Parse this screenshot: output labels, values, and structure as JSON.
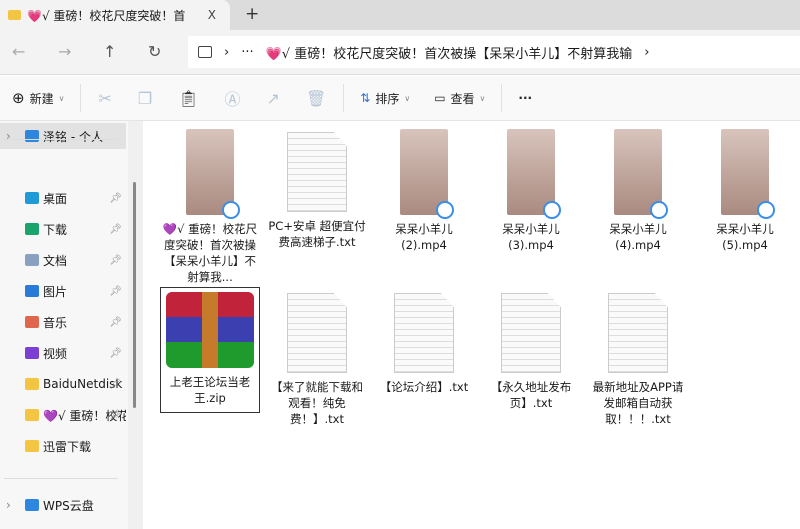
{
  "tab": {
    "title": "💗√ 重磅！校花尺度突破！首",
    "close": "X",
    "new": "+"
  },
  "nav": {
    "back": "←",
    "forward": "→",
    "up": "↑",
    "refresh": "↻",
    "sep": "›",
    "more": "···",
    "path": "💗√ 重磅！校花尺度突破！首次被操【呆呆小羊儿】不射算我输",
    "end": "›"
  },
  "toolbar": {
    "new": "新建",
    "sort": "排序",
    "view": "查看",
    "more": "···"
  },
  "sidebar": {
    "items": [
      {
        "label": "泽铭 - 个人",
        "color": "#2f86de"
      },
      {
        "label": "桌面",
        "color": "#1f9ad6"
      },
      {
        "label": "下载",
        "color": "#1aa36d"
      },
      {
        "label": "文档",
        "color": "#8aa0c0"
      },
      {
        "label": "图片",
        "color": "#2a7ad8"
      },
      {
        "label": "音乐",
        "color": "#e0664e"
      },
      {
        "label": "视频",
        "color": "#7b3fd2"
      },
      {
        "label": "BaiduNetdisk",
        "color": "#f4c542"
      },
      {
        "label": "💜√ 重磅！校花",
        "color": "#f4c542"
      },
      {
        "label": "迅雷下载",
        "color": "#f4c542"
      },
      {
        "label": "WPS云盘",
        "color": "#2f86de"
      }
    ]
  },
  "files": [
    {
      "name": "💜√ 重磅！校花尺度突破！首次被操【呆呆小羊儿】不射算我...",
      "type": "video"
    },
    {
      "name": "PC+安卓 超便宜付费高速梯子.txt",
      "type": "txt"
    },
    {
      "name": "呆呆小羊儿(2).mp4",
      "type": "video"
    },
    {
      "name": "呆呆小羊儿(3).mp4",
      "type": "video"
    },
    {
      "name": "呆呆小羊儿(4).mp4",
      "type": "video"
    },
    {
      "name": "呆呆小羊儿(5).mp4",
      "type": "video"
    },
    {
      "name": "上老王论坛当老王.zip",
      "type": "zip",
      "selected": true
    },
    {
      "name": "【来了就能下载和观看！纯免费！】.txt",
      "type": "txt"
    },
    {
      "name": "【论坛介绍】.txt",
      "type": "txt"
    },
    {
      "name": "【永久地址发布页】.txt",
      "type": "txt"
    },
    {
      "name": "最新地址及APP请发邮箱自动获取！！！.txt",
      "type": "txt"
    }
  ]
}
